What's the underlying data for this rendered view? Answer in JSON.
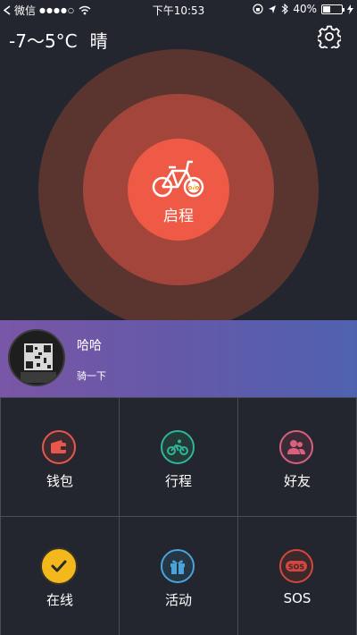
{
  "status_bar": {
    "carrier": "微信",
    "signal": "●●●●○",
    "time": "下午10:53",
    "battery_text": "40%",
    "battery_level": 0.4
  },
  "weather": {
    "temperature": "-7～5°C",
    "condition": "晴"
  },
  "start": {
    "label": "启程"
  },
  "profile": {
    "name": "哈哈",
    "subtitle": "骑一下"
  },
  "menu": [
    {
      "label": "钱包",
      "icon": "wallet-icon",
      "color": "#e8574b"
    },
    {
      "label": "行程",
      "icon": "bike-icon",
      "color": "#2fb59b"
    },
    {
      "label": "好友",
      "icon": "friends-icon",
      "color": "#d9607f"
    },
    {
      "label": "在线",
      "icon": "check-icon",
      "color": "#f2b81c"
    },
    {
      "label": "活动",
      "icon": "gift-icon",
      "color": "#4aa3d9"
    },
    {
      "label": "SOS",
      "icon": "sos-icon",
      "color": "#d6463f"
    }
  ],
  "colors": {
    "background": "#23262e",
    "ring_outer": "#5a3530",
    "ring_mid": "#a3453a",
    "ring_core": "#ee5a45",
    "profile_gradient_start": "#7a56a6",
    "profile_gradient_end": "#4f62b0"
  }
}
